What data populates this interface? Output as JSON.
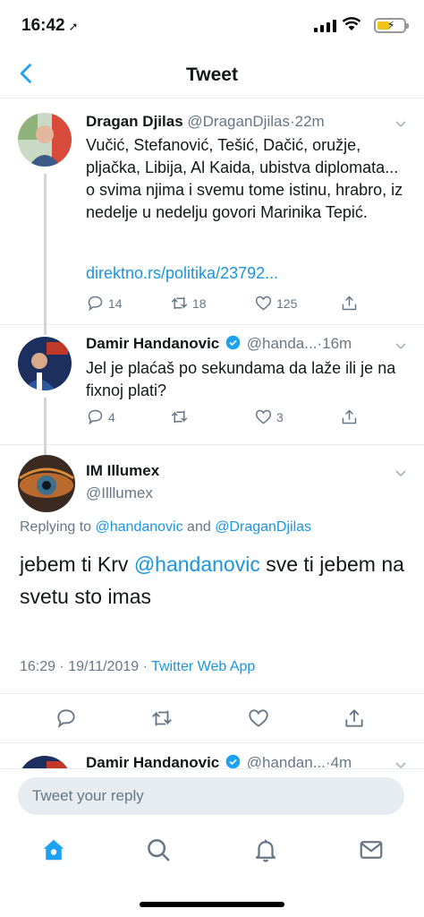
{
  "status": {
    "time": "16:42"
  },
  "nav": {
    "title": "Tweet"
  },
  "tweets": [
    {
      "name": "Dragan Djilas",
      "handle": "@DraganDjilas",
      "age": "22m",
      "text": "Vučić,  Stefanović, Tešić, Dačić,  oružje, pljačka, Libija, Al Kaida,  ubistva diplomata... o svima njima i svemu tome istinu, hrabro, iz nedelje u nedelju govori Marinika Tepić.",
      "link": "direktno.rs/politika/23792...",
      "replies": "14",
      "retweets": "18",
      "likes": "125"
    },
    {
      "name": "Damir Handanovic",
      "handle": "@handa...",
      "age": "16m",
      "text": "Jel je plaćaš po sekundama da laže ili je na fixnoj plati?",
      "replies": "4",
      "retweets": "",
      "likes": "3"
    }
  ],
  "focused": {
    "name": "IM Illumex",
    "handle": "@Illlumex",
    "replying_prefix": "Replying to ",
    "replying_to_1": "@handanovic",
    "replying_and": " and ",
    "replying_to_2": "@DraganDjilas",
    "text_before": "jebem ti Krv ",
    "text_mention": "@handanovic",
    "text_after": " sve ti jebem na svetu sto imas",
    "timestamp": "16:29 · 19/11/2019 · ",
    "app": "Twitter Web App"
  },
  "next_tweet": {
    "name": "Damir Handanovic",
    "handle": "@handan...",
    "age": "4m"
  },
  "composer": {
    "placeholder": "Tweet your reply"
  },
  "colors": {
    "accent": "#1da1f2",
    "link": "#1b95e0",
    "muted": "#657786"
  }
}
